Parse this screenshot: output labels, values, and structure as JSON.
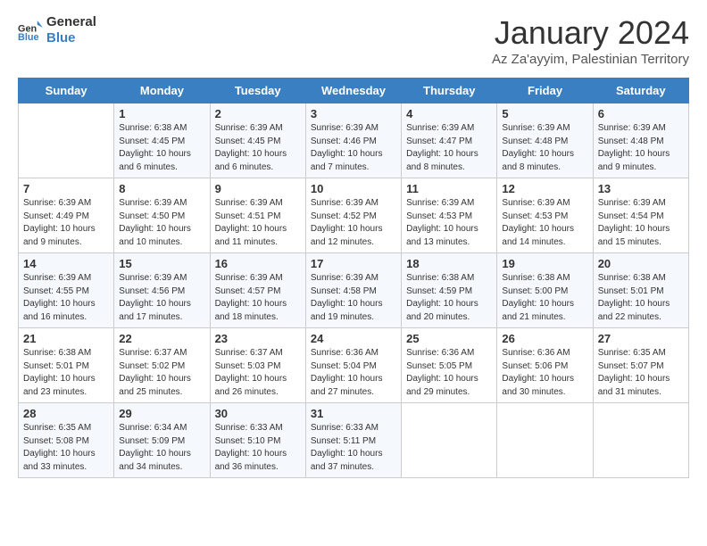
{
  "header": {
    "logo_general": "General",
    "logo_blue": "Blue",
    "month_title": "January 2024",
    "subtitle": "Az Za'ayyim, Palestinian Territory"
  },
  "days_of_week": [
    "Sunday",
    "Monday",
    "Tuesday",
    "Wednesday",
    "Thursday",
    "Friday",
    "Saturday"
  ],
  "weeks": [
    [
      {
        "day": "",
        "sunrise": "",
        "sunset": "",
        "daylight": ""
      },
      {
        "day": "1",
        "sunrise": "Sunrise: 6:38 AM",
        "sunset": "Sunset: 4:45 PM",
        "daylight": "Daylight: 10 hours and 6 minutes."
      },
      {
        "day": "2",
        "sunrise": "Sunrise: 6:39 AM",
        "sunset": "Sunset: 4:45 PM",
        "daylight": "Daylight: 10 hours and 6 minutes."
      },
      {
        "day": "3",
        "sunrise": "Sunrise: 6:39 AM",
        "sunset": "Sunset: 4:46 PM",
        "daylight": "Daylight: 10 hours and 7 minutes."
      },
      {
        "day": "4",
        "sunrise": "Sunrise: 6:39 AM",
        "sunset": "Sunset: 4:47 PM",
        "daylight": "Daylight: 10 hours and 8 minutes."
      },
      {
        "day": "5",
        "sunrise": "Sunrise: 6:39 AM",
        "sunset": "Sunset: 4:48 PM",
        "daylight": "Daylight: 10 hours and 8 minutes."
      },
      {
        "day": "6",
        "sunrise": "Sunrise: 6:39 AM",
        "sunset": "Sunset: 4:48 PM",
        "daylight": "Daylight: 10 hours and 9 minutes."
      }
    ],
    [
      {
        "day": "7",
        "sunrise": "Sunrise: 6:39 AM",
        "sunset": "Sunset: 4:49 PM",
        "daylight": "Daylight: 10 hours and 9 minutes."
      },
      {
        "day": "8",
        "sunrise": "Sunrise: 6:39 AM",
        "sunset": "Sunset: 4:50 PM",
        "daylight": "Daylight: 10 hours and 10 minutes."
      },
      {
        "day": "9",
        "sunrise": "Sunrise: 6:39 AM",
        "sunset": "Sunset: 4:51 PM",
        "daylight": "Daylight: 10 hours and 11 minutes."
      },
      {
        "day": "10",
        "sunrise": "Sunrise: 6:39 AM",
        "sunset": "Sunset: 4:52 PM",
        "daylight": "Daylight: 10 hours and 12 minutes."
      },
      {
        "day": "11",
        "sunrise": "Sunrise: 6:39 AM",
        "sunset": "Sunset: 4:53 PM",
        "daylight": "Daylight: 10 hours and 13 minutes."
      },
      {
        "day": "12",
        "sunrise": "Sunrise: 6:39 AM",
        "sunset": "Sunset: 4:53 PM",
        "daylight": "Daylight: 10 hours and 14 minutes."
      },
      {
        "day": "13",
        "sunrise": "Sunrise: 6:39 AM",
        "sunset": "Sunset: 4:54 PM",
        "daylight": "Daylight: 10 hours and 15 minutes."
      }
    ],
    [
      {
        "day": "14",
        "sunrise": "Sunrise: 6:39 AM",
        "sunset": "Sunset: 4:55 PM",
        "daylight": "Daylight: 10 hours and 16 minutes."
      },
      {
        "day": "15",
        "sunrise": "Sunrise: 6:39 AM",
        "sunset": "Sunset: 4:56 PM",
        "daylight": "Daylight: 10 hours and 17 minutes."
      },
      {
        "day": "16",
        "sunrise": "Sunrise: 6:39 AM",
        "sunset": "Sunset: 4:57 PM",
        "daylight": "Daylight: 10 hours and 18 minutes."
      },
      {
        "day": "17",
        "sunrise": "Sunrise: 6:39 AM",
        "sunset": "Sunset: 4:58 PM",
        "daylight": "Daylight: 10 hours and 19 minutes."
      },
      {
        "day": "18",
        "sunrise": "Sunrise: 6:38 AM",
        "sunset": "Sunset: 4:59 PM",
        "daylight": "Daylight: 10 hours and 20 minutes."
      },
      {
        "day": "19",
        "sunrise": "Sunrise: 6:38 AM",
        "sunset": "Sunset: 5:00 PM",
        "daylight": "Daylight: 10 hours and 21 minutes."
      },
      {
        "day": "20",
        "sunrise": "Sunrise: 6:38 AM",
        "sunset": "Sunset: 5:01 PM",
        "daylight": "Daylight: 10 hours and 22 minutes."
      }
    ],
    [
      {
        "day": "21",
        "sunrise": "Sunrise: 6:38 AM",
        "sunset": "Sunset: 5:01 PM",
        "daylight": "Daylight: 10 hours and 23 minutes."
      },
      {
        "day": "22",
        "sunrise": "Sunrise: 6:37 AM",
        "sunset": "Sunset: 5:02 PM",
        "daylight": "Daylight: 10 hours and 25 minutes."
      },
      {
        "day": "23",
        "sunrise": "Sunrise: 6:37 AM",
        "sunset": "Sunset: 5:03 PM",
        "daylight": "Daylight: 10 hours and 26 minutes."
      },
      {
        "day": "24",
        "sunrise": "Sunrise: 6:36 AM",
        "sunset": "Sunset: 5:04 PM",
        "daylight": "Daylight: 10 hours and 27 minutes."
      },
      {
        "day": "25",
        "sunrise": "Sunrise: 6:36 AM",
        "sunset": "Sunset: 5:05 PM",
        "daylight": "Daylight: 10 hours and 29 minutes."
      },
      {
        "day": "26",
        "sunrise": "Sunrise: 6:36 AM",
        "sunset": "Sunset: 5:06 PM",
        "daylight": "Daylight: 10 hours and 30 minutes."
      },
      {
        "day": "27",
        "sunrise": "Sunrise: 6:35 AM",
        "sunset": "Sunset: 5:07 PM",
        "daylight": "Daylight: 10 hours and 31 minutes."
      }
    ],
    [
      {
        "day": "28",
        "sunrise": "Sunrise: 6:35 AM",
        "sunset": "Sunset: 5:08 PM",
        "daylight": "Daylight: 10 hours and 33 minutes."
      },
      {
        "day": "29",
        "sunrise": "Sunrise: 6:34 AM",
        "sunset": "Sunset: 5:09 PM",
        "daylight": "Daylight: 10 hours and 34 minutes."
      },
      {
        "day": "30",
        "sunrise": "Sunrise: 6:33 AM",
        "sunset": "Sunset: 5:10 PM",
        "daylight": "Daylight: 10 hours and 36 minutes."
      },
      {
        "day": "31",
        "sunrise": "Sunrise: 6:33 AM",
        "sunset": "Sunset: 5:11 PM",
        "daylight": "Daylight: 10 hours and 37 minutes."
      },
      {
        "day": "",
        "sunrise": "",
        "sunset": "",
        "daylight": ""
      },
      {
        "day": "",
        "sunrise": "",
        "sunset": "",
        "daylight": ""
      },
      {
        "day": "",
        "sunrise": "",
        "sunset": "",
        "daylight": ""
      }
    ]
  ]
}
